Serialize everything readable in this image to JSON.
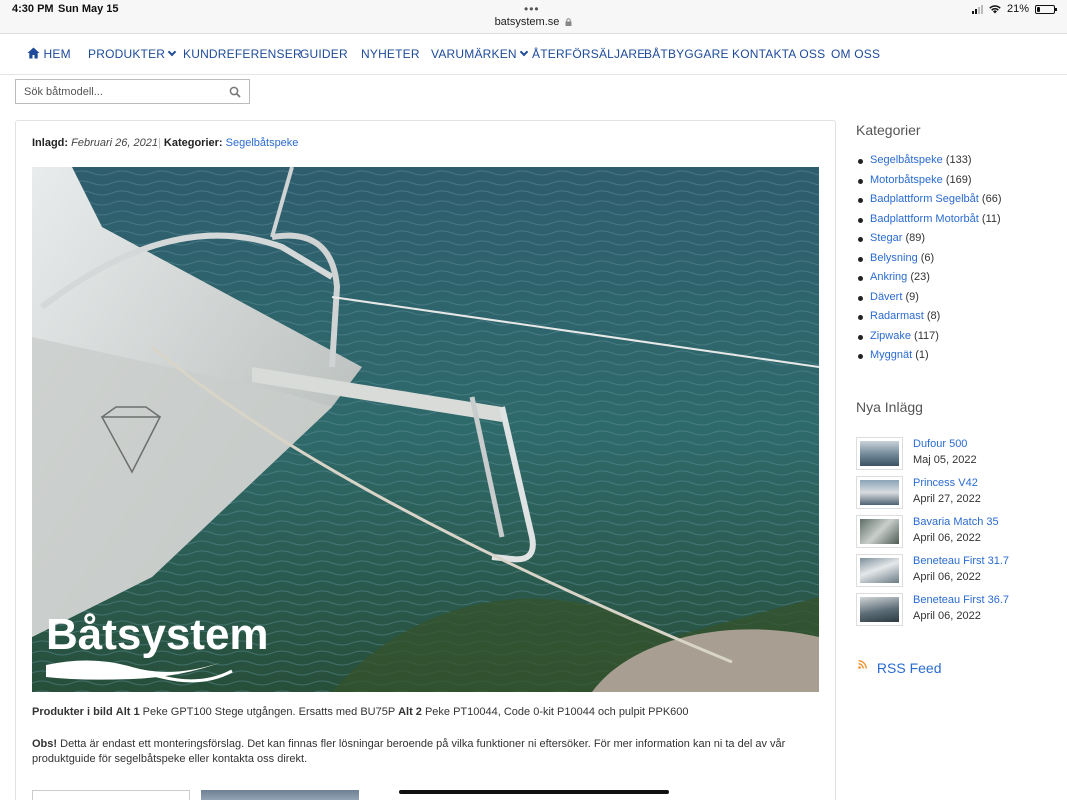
{
  "statusbar": {
    "time": "4:30 PM",
    "date": "Sun May 15",
    "url": "batsystem.se",
    "battery": "21%",
    "battery_level": 0.21
  },
  "nav": {
    "home": "HEM",
    "produkter": "PRODUKTER",
    "kundreferenser": "KUNDREFERENSER",
    "guider": "GUIDER",
    "nyheter": "NYHETER",
    "varumarken": "VARUMÄRKEN",
    "aterforsaljare": "ÅTERFÖRSÄLJARE",
    "batbyggare": "BÅTBYGGARE",
    "kontakta": "KONTAKTA OSS",
    "om": "OM OSS"
  },
  "search": {
    "placeholder": "Sök båtmodell..."
  },
  "post": {
    "posted_label": "Inlagd:",
    "posted_date": "Februari 26, 2021",
    "separator": "|",
    "category_label": "Kategorier:",
    "category": "Segelbåtspeke",
    "image_brand": "Båtsystem",
    "products_label": "Produkter i bild",
    "alt1_label": "Alt 1",
    "alt1_text": "Peke GPT100 Stege utgången. Ersatts med BU75P",
    "alt2_label": "Alt 2",
    "alt2_text": "Peke PT10044, Code 0-kit P10044 och pulpit PPK600",
    "obs_label": "Obs!",
    "obs_text": "Detta är endast ett monteringsförslag. Det kan finnas fler lösningar beroende på vilka funktioner ni eftersöker. För mer information kan ni ta del av vår produktguide för segelbåtspeke eller kontakta oss direkt."
  },
  "sidebar": {
    "categories_title": "Kategorier",
    "categories": [
      {
        "name": "Segelbåtspeke",
        "count": "(133)"
      },
      {
        "name": "Motorbåtspeke",
        "count": "(169)"
      },
      {
        "name": "Badplattform Segelbåt",
        "count": "(66)"
      },
      {
        "name": "Badplattform Motorbåt",
        "count": "(11)"
      },
      {
        "name": "Stegar",
        "count": "(89)"
      },
      {
        "name": "Belysning",
        "count": "(6)"
      },
      {
        "name": "Ankring",
        "count": "(23)"
      },
      {
        "name": "Dävert",
        "count": "(9)"
      },
      {
        "name": "Radarmast",
        "count": "(8)"
      },
      {
        "name": "Zipwake",
        "count": "(117)"
      },
      {
        "name": "Myggnät",
        "count": "(1)"
      }
    ],
    "recent_title": "Nya Inlägg",
    "recent": [
      {
        "title": "Dufour 500",
        "date": "Maj 05, 2022"
      },
      {
        "title": "Princess V42",
        "date": "April 27, 2022"
      },
      {
        "title": "Bavaria Match 35",
        "date": "April 06, 2022"
      },
      {
        "title": "Beneteau First 31.7",
        "date": "April 06, 2022"
      },
      {
        "title": "Beneteau First 36.7",
        "date": "April 06, 2022"
      }
    ],
    "rss": "RSS Feed"
  },
  "colors": {
    "link": "#2a6bd0",
    "nav": "#1d4a9a"
  }
}
